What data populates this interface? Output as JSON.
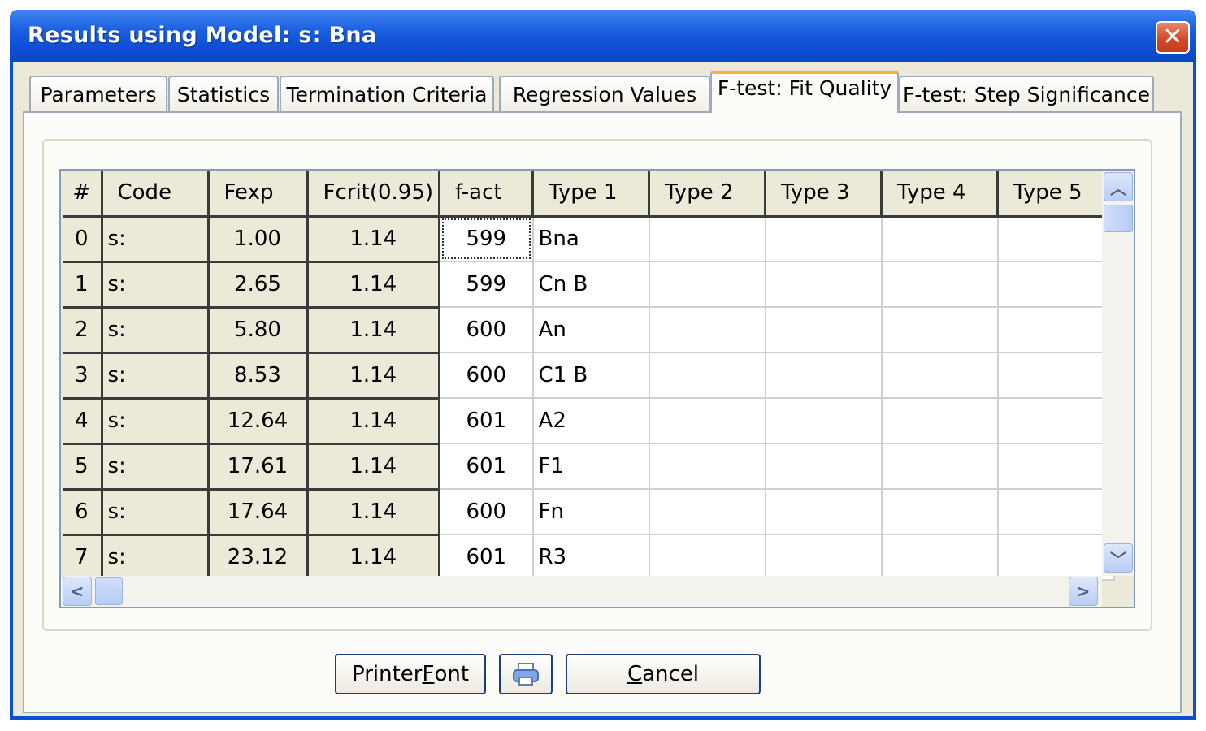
{
  "window": {
    "title": "Results using Model: s:  Bna",
    "close_glyph": "✕"
  },
  "tabs": [
    {
      "label": "Parameters"
    },
    {
      "label": "Statistics"
    },
    {
      "label": "Termination Criteria"
    },
    {
      "label": "Regression Values"
    },
    {
      "label": "F-test: Fit Quality",
      "active": true
    },
    {
      "label": "F-test: Step Significance"
    }
  ],
  "grid": {
    "columns": [
      "#",
      "Code",
      "Fexp",
      "Fcrit(0.95)",
      "f-act",
      "Type 1",
      "Type 2",
      "Type 3",
      "Type 4",
      "Type 5"
    ],
    "rows": [
      [
        "0",
        "s:",
        "1.00",
        "1.14",
        "599",
        "Bna",
        "",
        "",
        "",
        ""
      ],
      [
        "1",
        "s:",
        "2.65",
        "1.14",
        "599",
        "Cn B",
        "",
        "",
        "",
        ""
      ],
      [
        "2",
        "s:",
        "5.80",
        "1.14",
        "600",
        "An",
        "",
        "",
        "",
        ""
      ],
      [
        "3",
        "s:",
        "8.53",
        "1.14",
        "600",
        "C1 B",
        "",
        "",
        "",
        ""
      ],
      [
        "4",
        "s:",
        "12.64",
        "1.14",
        "601",
        "A2",
        "",
        "",
        "",
        ""
      ],
      [
        "5",
        "s:",
        "17.61",
        "1.14",
        "601",
        "F1",
        "",
        "",
        "",
        ""
      ],
      [
        "6",
        "s:",
        "17.64",
        "1.14",
        "600",
        "Fn",
        "",
        "",
        "",
        ""
      ],
      [
        "7",
        "s:",
        "23.12",
        "1.14",
        "601",
        "R3",
        "",
        "",
        "",
        ""
      ]
    ]
  },
  "buttons": {
    "printer_font_label_pre": "Printer ",
    "printer_font_label_mnemonic": "F",
    "printer_font_label_post": "ont",
    "print_icon": "printer-icon",
    "cancel_label_mnemonic": "C",
    "cancel_label_post": "ancel"
  },
  "colors": {
    "titlebar": "#0a4fd4",
    "active_tab_accent": "#f5b13a",
    "dialog_bg": "#ece9d8"
  }
}
